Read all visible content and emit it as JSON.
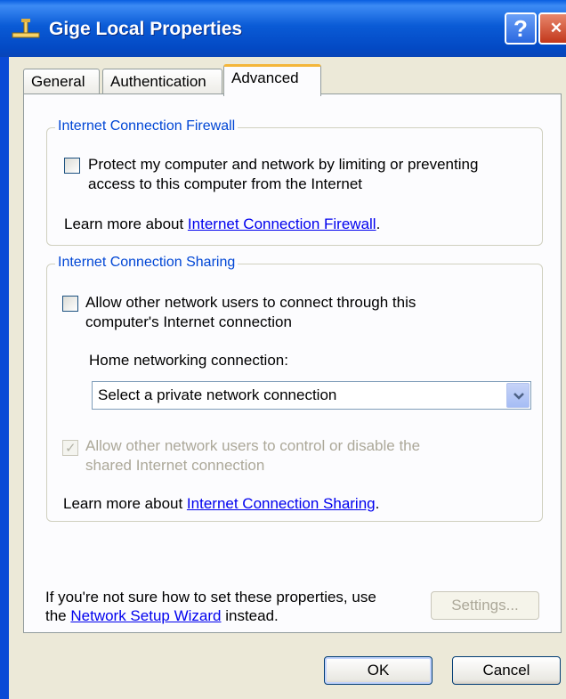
{
  "window": {
    "title": "Gige Local Properties",
    "help_label": "?",
    "close_label": "✕",
    "accent_color": "#0a5bd6"
  },
  "tabs": [
    {
      "label": "General",
      "active": false
    },
    {
      "label": "Authentication",
      "active": false
    },
    {
      "label": "Advanced",
      "active": true
    }
  ],
  "firewall": {
    "title": "Internet Connection Firewall",
    "checkbox_label_line1": "Protect my computer and network by limiting or preventing",
    "checkbox_label_line2": "access to this computer from the Internet",
    "checked": false,
    "learn_prefix": "Learn more about ",
    "learn_link": "Internet Connection Firewall",
    "learn_suffix": "."
  },
  "sharing": {
    "title": "Internet Connection Sharing",
    "allow_label_line1": "Allow other network users to connect through this",
    "allow_label_line2": "computer's Internet connection",
    "allow_checked": false,
    "home_label": "Home networking connection:",
    "select_value": "Select a private network connection",
    "control_label_line1": "Allow other network users to control or disable the",
    "control_label_line2": "shared Internet connection",
    "control_checked": true,
    "control_disabled": true,
    "learn_prefix": "Learn more about ",
    "learn_link": "Internet Connection Sharing",
    "learn_suffix": "."
  },
  "footer": {
    "info_line1": "If you're not sure how to set these properties, use",
    "info_prefix": "the ",
    "wizard_link": "Network Setup Wizard",
    "info_suffix": " instead.",
    "settings_label": "Settings..."
  },
  "buttons": {
    "ok_label": "OK",
    "cancel_label": "Cancel"
  }
}
